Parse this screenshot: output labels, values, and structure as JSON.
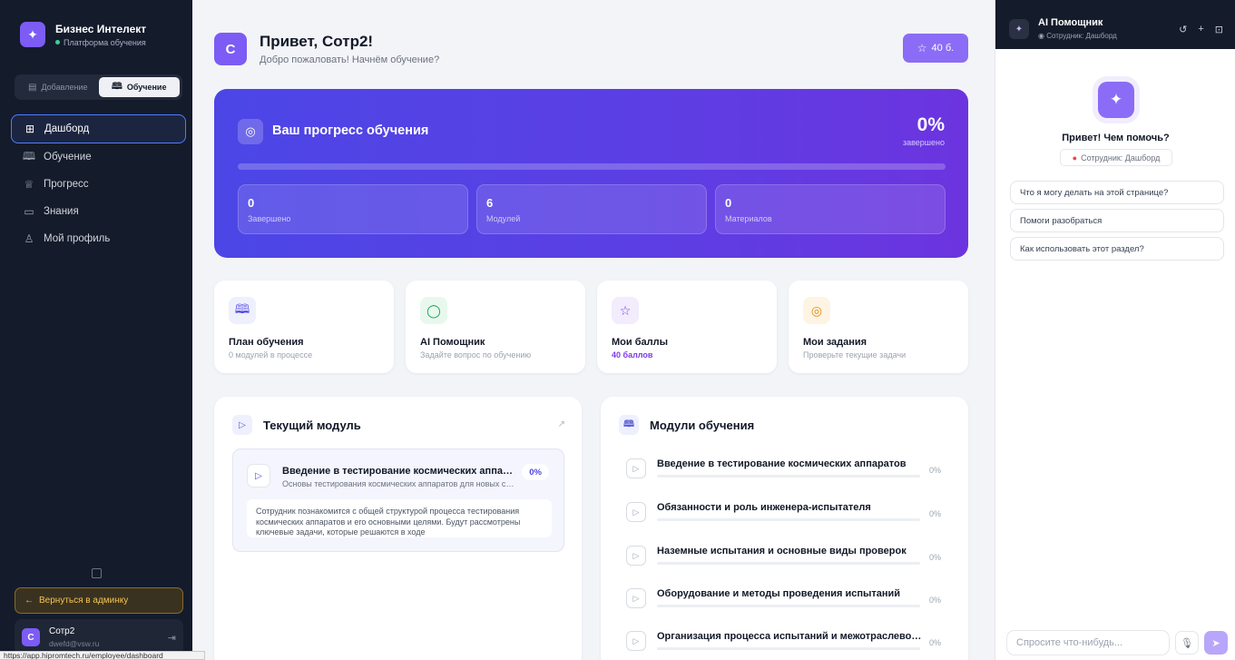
{
  "sidebar": {
    "brand_title": "Бизнес Интелект",
    "brand_sub": "Платформа обучения",
    "modes": [
      "Добавление",
      "Обучение"
    ],
    "nav": [
      {
        "label": "Дашборд",
        "icon": "grid-icon"
      },
      {
        "label": "Обучение",
        "icon": "book-icon"
      },
      {
        "label": "Прогресс",
        "icon": "trophy-icon"
      },
      {
        "label": "Знания",
        "icon": "folder-icon"
      },
      {
        "label": "Мой профиль",
        "icon": "user-icon"
      }
    ],
    "back_label": "Вернуться в админку",
    "user_initial": "С",
    "user_name": "Сотр2",
    "user_email": "dwefd@vsw.ru",
    "status_url": "https://app.hipromtech.ru/employee/dashboard"
  },
  "header": {
    "initial": "С",
    "title": "Привет, Сотр2!",
    "subtitle": "Добро пожаловать! Начнём обучение?",
    "points_label": "40 б."
  },
  "progress": {
    "title": "Ваш прогресс обучения",
    "percent": "0%",
    "percent_value": 0,
    "percent_caption": "завершено",
    "stats": [
      {
        "value": "0",
        "label": "Завершено"
      },
      {
        "value": "6",
        "label": "Модулей"
      },
      {
        "value": "0",
        "label": "Материалов"
      }
    ]
  },
  "tiles": [
    {
      "title": "План обучения",
      "sub": "0 модулей в процессе",
      "icon": "book-icon",
      "color": "#4f46e5",
      "bg": "#eef0fd"
    },
    {
      "title": "AI Помощник",
      "sub": "Задайте вопрос по обучению",
      "icon": "chat-icon",
      "color": "#16a34a",
      "bg": "#e8f8ee"
    },
    {
      "title": "Мои баллы",
      "sub": "40 баллов",
      "icon": "star-icon",
      "color": "#7c3aed",
      "bg": "#f2ecfd"
    },
    {
      "title": "Мои задания",
      "sub": "Проверьте текущие задачи",
      "icon": "target-icon",
      "color": "#ea8a0c",
      "bg": "#fdf4e4"
    }
  ],
  "current_module": {
    "heading": "Текущий модуль",
    "title": "Введение в тестирование космических аппаратов",
    "subtitle": "Основы тестирования космических аппаратов для новых сотрудников",
    "percent": "0%",
    "description": "Сотрудник познакомится с общей структурой процесса тестирования космических аппаратов и его основными целями. Будут рассмотрены ключевые задачи, которые решаются в ходе"
  },
  "modules": {
    "heading": "Модули обучения",
    "items": [
      {
        "title": "Введение в тестирование космических аппаратов",
        "percent": "0%"
      },
      {
        "title": "Обязанности и роль инженера-испытателя",
        "percent": "0%"
      },
      {
        "title": "Наземные испытания и основные виды проверок",
        "percent": "0%"
      },
      {
        "title": "Оборудование и методы проведения испытаний",
        "percent": "0%"
      },
      {
        "title": "Организация процесса испытаний и межотраслевого взаимодействия",
        "percent": "0%"
      }
    ]
  },
  "assistant": {
    "title": "AI Помощник",
    "context": "Сотрудник: Дашборд",
    "greeting": "Привет! Чем помочь?",
    "chip": "Сотрудник: Дашборд",
    "suggestions": [
      "Что я могу делать на этой странице?",
      "Помоги разобраться",
      "Как использовать этот раздел?"
    ],
    "input_placeholder": "Спросите что-нибудь..."
  }
}
